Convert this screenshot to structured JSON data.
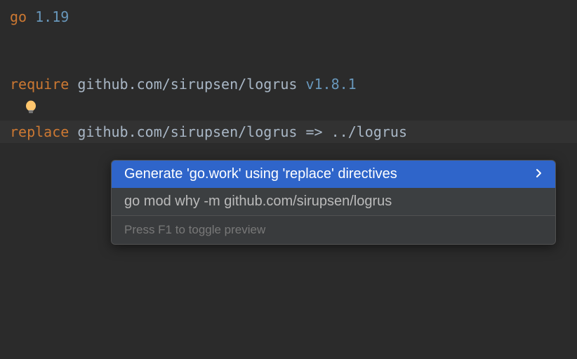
{
  "code": {
    "line1_kw": "go",
    "line1_ver": "1.19",
    "line3_kw": "require",
    "line3_path": "github.com/sirupsen/logrus",
    "line3_ver": "v1.8.1",
    "line5_kw": "replace",
    "line5_path": "github.com/sirupsen/logrus",
    "line5_arrow": "=>",
    "line5_target": "../logrus"
  },
  "popup": {
    "item1": "Generate 'go.work' using 'replace' directives",
    "item2": "go mod why -m github.com/sirupsen/logrus",
    "footer": "Press F1 to toggle preview"
  }
}
